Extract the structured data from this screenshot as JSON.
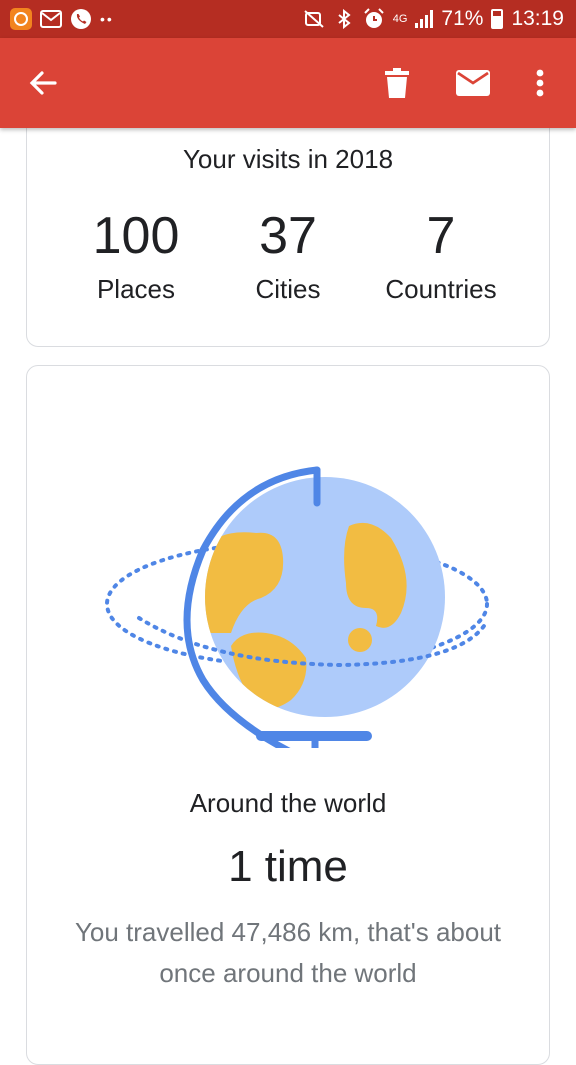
{
  "status_bar": {
    "network": "4G",
    "battery_percent": "71%",
    "time": "13:19",
    "battery_level": 0.71
  },
  "app_bar": {
    "icons": [
      "arrow-back-icon",
      "trash-icon",
      "mail-icon",
      "more-vert-icon"
    ]
  },
  "visits_card": {
    "title": "Your visits in 2018",
    "stats": [
      {
        "value": "100",
        "label": "Places"
      },
      {
        "value": "37",
        "label": "Cities"
      },
      {
        "value": "7",
        "label": "Countries"
      }
    ]
  },
  "world_card": {
    "title": "Around the world",
    "count": "1 time",
    "description": "You travelled 47,486 km, that's about once around the world"
  },
  "colors": {
    "status_bar": "#b52d22",
    "app_bar": "#db4437",
    "globe_blue": "#aecbfa",
    "globe_stand": "#4f86e6",
    "land": "#f2bc42"
  }
}
